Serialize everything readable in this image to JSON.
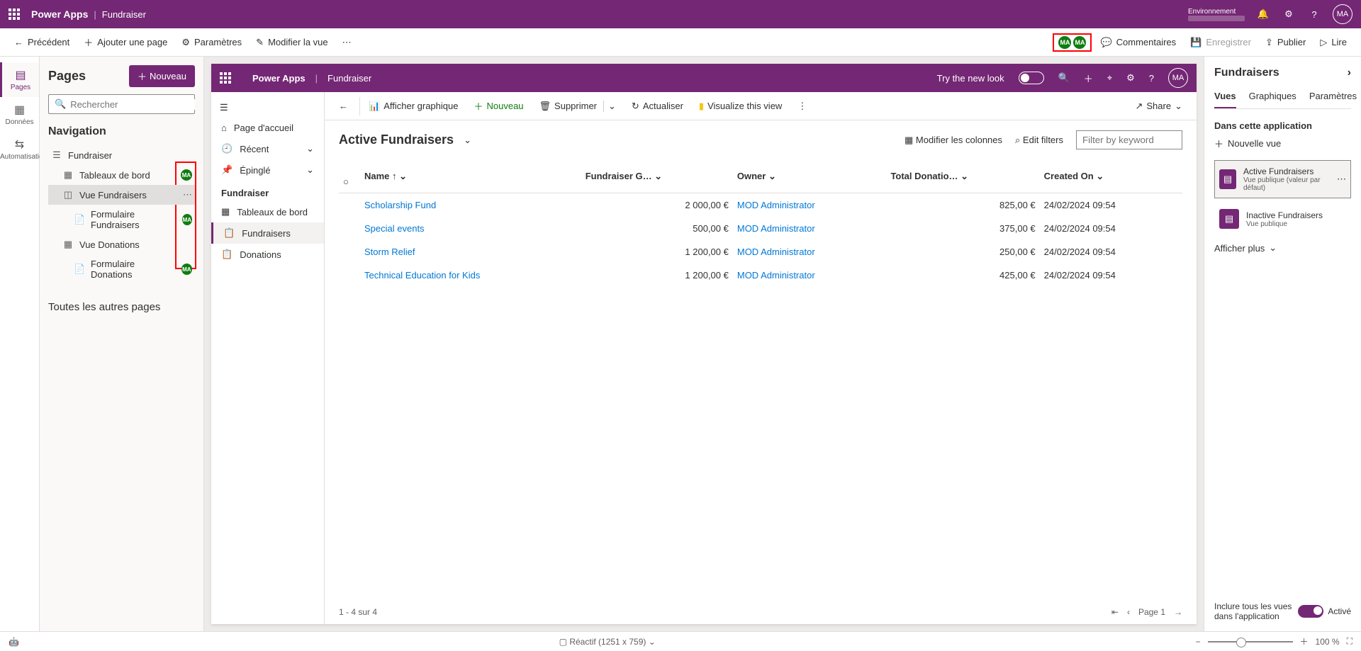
{
  "header": {
    "product": "Power Apps",
    "separator": "|",
    "app": "Fundraiser",
    "env_label": "Environnement",
    "avatar": "MA"
  },
  "cmdbar": {
    "back": "Précédent",
    "addPage": "Ajouter une page",
    "settings": "Paramètres",
    "modifyView": "Modifier la vue",
    "comments": "Commentaires",
    "save": "Enregistrer",
    "publish": "Publier",
    "play": "Lire"
  },
  "rail": {
    "pages": "Pages",
    "data": "Données",
    "automation": "Automatisation"
  },
  "pagesPanel": {
    "title": "Pages",
    "new": "Nouveau",
    "searchPlaceholder": "Rechercher",
    "navTitle": "Navigation",
    "items": [
      {
        "label": "Fundraiser",
        "icon": "list"
      },
      {
        "label": "Tableaux de bord",
        "icon": "grid",
        "badge": "MA"
      },
      {
        "label": "Vue Fundraisers",
        "icon": "shapes",
        "selected": true,
        "ellipsis": true
      },
      {
        "label": "Formulaire Fundraisers",
        "icon": "form",
        "badge": "MA"
      },
      {
        "label": "Vue Donations",
        "icon": "grid2"
      },
      {
        "label": "Formulaire Donations",
        "icon": "form",
        "badge": "MA"
      }
    ],
    "otherPages": "Toutes les autres pages"
  },
  "preview": {
    "topProduct": "Power Apps",
    "topApp": "Fundraiser",
    "tryNew": "Try the new look",
    "nav": {
      "home": "Page d'accueil",
      "recent": "Récent",
      "pinned": "Épinglé",
      "section": "Fundraiser",
      "dashboards": "Tableaux de bord",
      "fundraisers": "Fundraisers",
      "donations": "Donations"
    },
    "cmd": {
      "chart": "Afficher graphique",
      "new": "Nouveau",
      "delete": "Supprimer",
      "refresh": "Actualiser",
      "visualize": "Visualize this view",
      "share": "Share"
    },
    "viewTitle": "Active Fundraisers",
    "editCols": "Modifier les colonnes",
    "editFilters": "Edit filters",
    "filterPlaceholder": "Filter by keyword",
    "columns": [
      "Name ↑",
      "Fundraiser G…",
      "Owner",
      "Total Donatio…",
      "Created On"
    ],
    "rows": [
      {
        "name": "Scholarship Fund",
        "goal": "2 000,00 €",
        "owner": "MOD Administrator",
        "total": "825,00 €",
        "created": "24/02/2024 09:54"
      },
      {
        "name": "Special events",
        "goal": "500,00 €",
        "owner": "MOD Administrator",
        "total": "375,00 €",
        "created": "24/02/2024 09:54"
      },
      {
        "name": "Storm Relief",
        "goal": "1 200,00 €",
        "owner": "MOD Administrator",
        "total": "250,00 €",
        "created": "24/02/2024 09:54"
      },
      {
        "name": "Technical Education for Kids",
        "goal": "1 200,00 €",
        "owner": "MOD Administrator",
        "total": "425,00 €",
        "created": "24/02/2024 09:54"
      }
    ],
    "footerCount": "1 - 4 sur 4",
    "page": "Page 1"
  },
  "rightPanel": {
    "title": "Fundraisers",
    "tabs": [
      "Vues",
      "Graphiques",
      "Paramètres"
    ],
    "section": "Dans cette application",
    "newView": "Nouvelle vue",
    "views": [
      {
        "title": "Active Fundraisers",
        "sub": "Vue publique (valeur par défaut)",
        "sel": true
      },
      {
        "title": "Inactive Fundraisers",
        "sub": "Vue publique"
      }
    ],
    "showMore": "Afficher plus",
    "includeAll": "Inclure tous les vues dans l'application",
    "enabled": "Activé"
  },
  "status": {
    "responsive": "Réactif (1251 x 759)",
    "zoom": "100 %"
  }
}
